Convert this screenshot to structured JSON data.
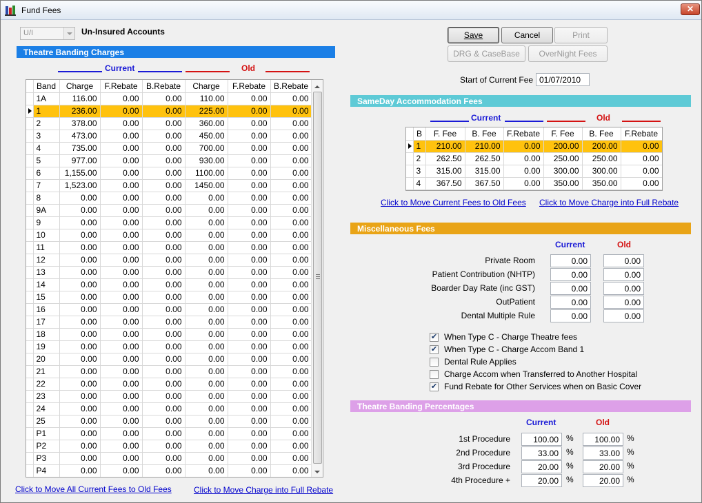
{
  "window": {
    "title": "Fund Fees",
    "close_glyph": "✕"
  },
  "account_type": {
    "selected": "U/I",
    "label": "Un-Insured Accounts"
  },
  "theatre_banding": {
    "header": "Theatre Banding Charges",
    "current_label": "Current",
    "old_label": "Old",
    "columns": [
      "Band",
      "Charge",
      "F.Rebate",
      "B.Rebate",
      "Charge",
      "F.Rebate",
      "B.Rebate"
    ],
    "selected_index": 1,
    "rows": [
      [
        "1A",
        "116.00",
        "0.00",
        "0.00",
        "110.00",
        "0.00",
        "0.00"
      ],
      [
        "1",
        "236.00",
        "0.00",
        "0.00",
        "225.00",
        "0.00",
        "0.00"
      ],
      [
        "2",
        "378.00",
        "0.00",
        "0.00",
        "360.00",
        "0.00",
        "0.00"
      ],
      [
        "3",
        "473.00",
        "0.00",
        "0.00",
        "450.00",
        "0.00",
        "0.00"
      ],
      [
        "4",
        "735.00",
        "0.00",
        "0.00",
        "700.00",
        "0.00",
        "0.00"
      ],
      [
        "5",
        "977.00",
        "0.00",
        "0.00",
        "930.00",
        "0.00",
        "0.00"
      ],
      [
        "6",
        "1,155.00",
        "0.00",
        "0.00",
        "1100.00",
        "0.00",
        "0.00"
      ],
      [
        "7",
        "1,523.00",
        "0.00",
        "0.00",
        "1450.00",
        "0.00",
        "0.00"
      ],
      [
        "8",
        "0.00",
        "0.00",
        "0.00",
        "0.00",
        "0.00",
        "0.00"
      ],
      [
        "9A",
        "0.00",
        "0.00",
        "0.00",
        "0.00",
        "0.00",
        "0.00"
      ],
      [
        "9",
        "0.00",
        "0.00",
        "0.00",
        "0.00",
        "0.00",
        "0.00"
      ],
      [
        "10",
        "0.00",
        "0.00",
        "0.00",
        "0.00",
        "0.00",
        "0.00"
      ],
      [
        "11",
        "0.00",
        "0.00",
        "0.00",
        "0.00",
        "0.00",
        "0.00"
      ],
      [
        "12",
        "0.00",
        "0.00",
        "0.00",
        "0.00",
        "0.00",
        "0.00"
      ],
      [
        "13",
        "0.00",
        "0.00",
        "0.00",
        "0.00",
        "0.00",
        "0.00"
      ],
      [
        "14",
        "0.00",
        "0.00",
        "0.00",
        "0.00",
        "0.00",
        "0.00"
      ],
      [
        "15",
        "0.00",
        "0.00",
        "0.00",
        "0.00",
        "0.00",
        "0.00"
      ],
      [
        "16",
        "0.00",
        "0.00",
        "0.00",
        "0.00",
        "0.00",
        "0.00"
      ],
      [
        "17",
        "0.00",
        "0.00",
        "0.00",
        "0.00",
        "0.00",
        "0.00"
      ],
      [
        "18",
        "0.00",
        "0.00",
        "0.00",
        "0.00",
        "0.00",
        "0.00"
      ],
      [
        "19",
        "0.00",
        "0.00",
        "0.00",
        "0.00",
        "0.00",
        "0.00"
      ],
      [
        "20",
        "0.00",
        "0.00",
        "0.00",
        "0.00",
        "0.00",
        "0.00"
      ],
      [
        "21",
        "0.00",
        "0.00",
        "0.00",
        "0.00",
        "0.00",
        "0.00"
      ],
      [
        "22",
        "0.00",
        "0.00",
        "0.00",
        "0.00",
        "0.00",
        "0.00"
      ],
      [
        "23",
        "0.00",
        "0.00",
        "0.00",
        "0.00",
        "0.00",
        "0.00"
      ],
      [
        "24",
        "0.00",
        "0.00",
        "0.00",
        "0.00",
        "0.00",
        "0.00"
      ],
      [
        "25",
        "0.00",
        "0.00",
        "0.00",
        "0.00",
        "0.00",
        "0.00"
      ],
      [
        "P1",
        "0.00",
        "0.00",
        "0.00",
        "0.00",
        "0.00",
        "0.00"
      ],
      [
        "P2",
        "0.00",
        "0.00",
        "0.00",
        "0.00",
        "0.00",
        "0.00"
      ],
      [
        "P3",
        "0.00",
        "0.00",
        "0.00",
        "0.00",
        "0.00",
        "0.00"
      ],
      [
        "P4",
        "0.00",
        "0.00",
        "0.00",
        "0.00",
        "0.00",
        "0.00"
      ]
    ],
    "link_move_current": "Click to Move All Current Fees to Old Fees",
    "link_move_rebate": "Click to Move Charge into Full Rebate"
  },
  "toolbar": {
    "save_label": "Save",
    "cancel_label": "Cancel",
    "print_label": "Print",
    "drg_label": "DRG & CaseBase",
    "overnight_label": "OverNight Fees"
  },
  "start_fee": {
    "label": "Start of Current Fee",
    "value": "01/07/2010"
  },
  "sameday": {
    "header": "SameDay Accommodation Fees",
    "current_label": "Current",
    "old_label": "Old",
    "columns": [
      "B",
      "F. Fee",
      "B. Fee",
      "F.Rebate",
      "F. Fee",
      "B. Fee",
      "F.Rebate"
    ],
    "selected_index": 0,
    "rows": [
      [
        "1",
        "210.00",
        "210.00",
        "0.00",
        "200.00",
        "200.00",
        "0.00"
      ],
      [
        "2",
        "262.50",
        "262.50",
        "0.00",
        "250.00",
        "250.00",
        "0.00"
      ],
      [
        "3",
        "315.00",
        "315.00",
        "0.00",
        "300.00",
        "300.00",
        "0.00"
      ],
      [
        "4",
        "367.50",
        "367.50",
        "0.00",
        "350.00",
        "350.00",
        "0.00"
      ]
    ],
    "link_move_current": "Click to Move Current Fees to Old Fees",
    "link_move_rebate": "Click to Move Charge into Full Rebate"
  },
  "misc": {
    "header": "Miscellaneous Fees",
    "current_label": "Current",
    "old_label": "Old",
    "rows": [
      {
        "label": "Private Room",
        "current": "0.00",
        "old": "0.00"
      },
      {
        "label": "Patient Contribution (NHTP)",
        "current": "0.00",
        "old": "0.00"
      },
      {
        "label": "Boarder Day Rate (inc GST)",
        "current": "0.00",
        "old": "0.00"
      },
      {
        "label": "OutPatient",
        "current": "0.00",
        "old": "0.00"
      },
      {
        "label": "Dental Multiple Rule",
        "current": "0.00",
        "old": "0.00"
      }
    ],
    "checks": [
      {
        "label": "When Type C - Charge Theatre fees",
        "checked": true
      },
      {
        "label": "When Type C - Charge Accom Band 1",
        "checked": true
      },
      {
        "label": "Dental Rule Applies",
        "checked": false
      },
      {
        "label": "Charge Accom when Transferred to Another Hospital",
        "checked": false
      },
      {
        "label": "Fund Rebate for Other Services when on Basic Cover",
        "checked": true
      }
    ],
    "check_glyph": "✔"
  },
  "percentages": {
    "header": "Theatre Banding Percentages",
    "current_label": "Current",
    "old_label": "Old",
    "pct_symbol": "%",
    "rows": [
      {
        "label": "1st Procedure",
        "current": "100.00",
        "old": "100.00"
      },
      {
        "label": "2nd Procedure",
        "current": "33.00",
        "old": "33.00"
      },
      {
        "label": "3rd Procedure",
        "current": "20.00",
        "old": "20.00"
      },
      {
        "label": "4th Procedure +",
        "current": "20.00",
        "old": "20.00"
      }
    ]
  },
  "colors": {
    "theatre_header": "#1b7fe6",
    "sameday_header": "#5ecad6",
    "misc_header": "#e9a417",
    "pct_header": "#dda0e8",
    "selected_row": "#ffc20e",
    "current_blue": "#1a1ad6",
    "old_red": "#d41212"
  }
}
